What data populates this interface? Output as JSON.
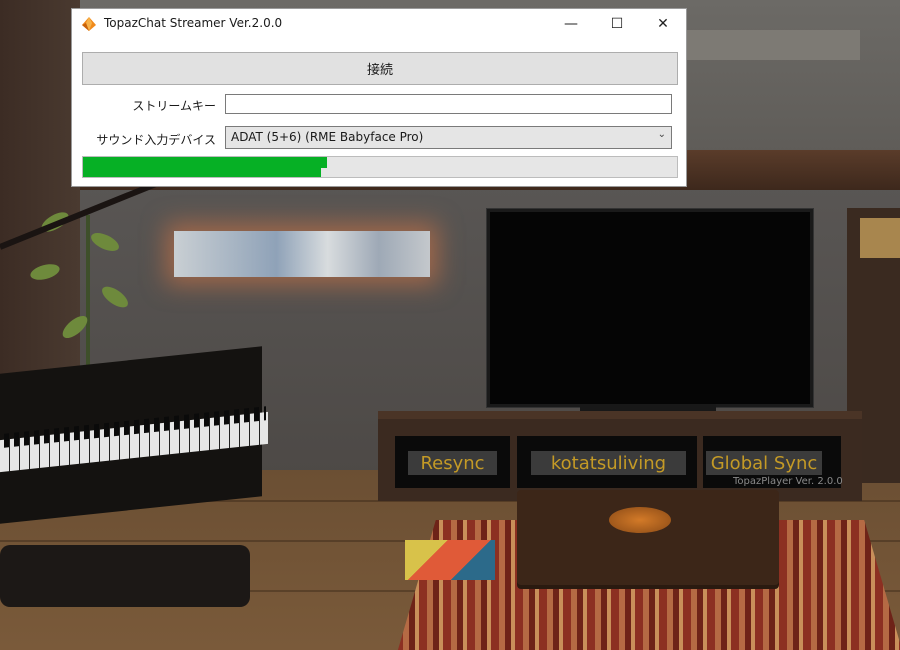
{
  "window": {
    "title": "TopazChat Streamer Ver.2.0.0",
    "minimize_glyph": "—",
    "maximize_glyph": "☐",
    "close_glyph": "✕"
  },
  "form": {
    "connect_label": "接続",
    "stream_key_label": "ストリームキー",
    "stream_key_value": "",
    "sound_device_label": "サウンド入力デバイス",
    "sound_device_value": "ADAT (5+6) (RME Babyface Pro)",
    "level_meter_fraction": 0.4
  },
  "world": {
    "resync_label": "Resync",
    "channel_label": "kotatsuliving",
    "global_sync_label": "Global Sync",
    "player_version": "TopazPlayer Ver. 2.0.0"
  },
  "icons": {
    "app": "topaz-gem-icon",
    "device_dropdown": "chevron-down-icon"
  },
  "colors": {
    "progress": "#06b025",
    "world_button_text": "#c49a26",
    "world_button_bg": "#3b3b3b"
  }
}
